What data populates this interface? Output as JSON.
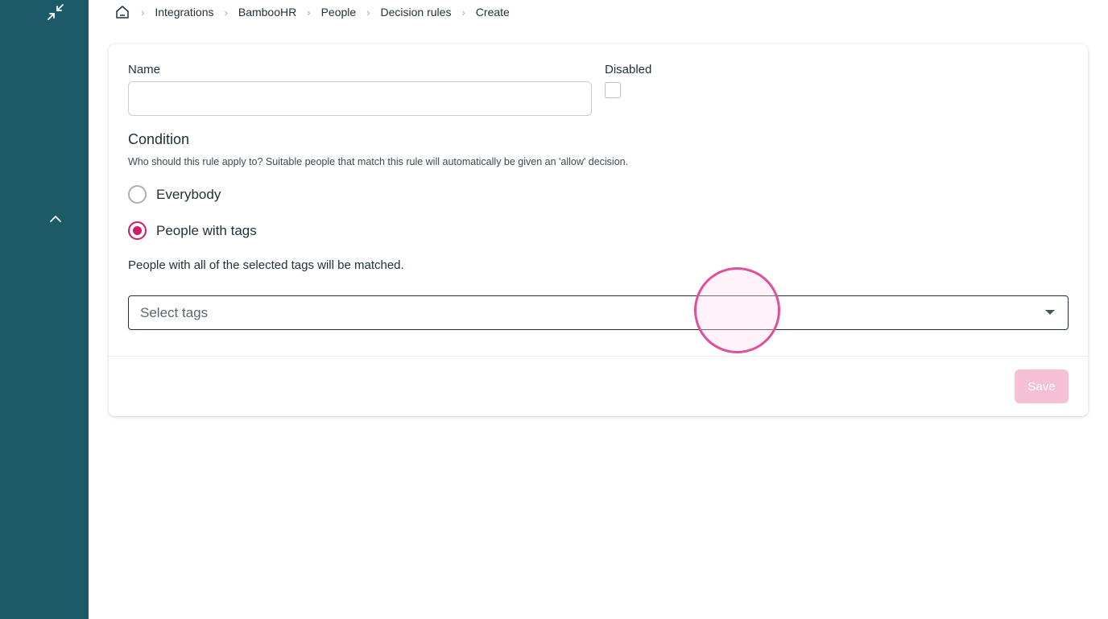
{
  "sidebar": {
    "collapse_icon": "collapse-arrows-icon",
    "chevron_icon": "chevron-up-icon",
    "background": "#1b5a66"
  },
  "breadcrumb": {
    "home_icon": "home-icon",
    "items": [
      "Integrations",
      "BambooHR",
      "People",
      "Decision rules",
      "Create"
    ]
  },
  "form": {
    "name_label": "Name",
    "name_value": "",
    "disabled_label": "Disabled",
    "disabled_checked": false,
    "condition_title": "Condition",
    "condition_description": "Who should this rule apply to? Suitable people that match this rule will automatically be given an 'allow' decision.",
    "options": [
      {
        "label": "Everybody",
        "selected": false
      },
      {
        "label": "People with tags",
        "selected": true
      }
    ],
    "tags_note": "People with all of the selected tags will be matched.",
    "tags_placeholder": "Select tags",
    "save_label": "Save"
  },
  "colors": {
    "accent": "#d01a6a",
    "save_disabled": "#f5bfd4"
  }
}
